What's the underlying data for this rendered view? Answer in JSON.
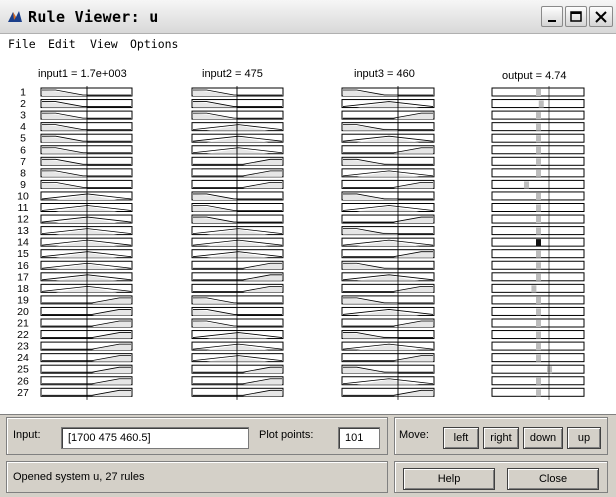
{
  "window": {
    "title": "Rule Viewer: u"
  },
  "menu": [
    "File",
    "Edit",
    "View",
    "Options"
  ],
  "columns": {
    "input1_label": "input1 = 1.7e+003",
    "input2_label": "input2 = 475",
    "input3_label": "input3 = 460",
    "output_label": "output = 4.74"
  },
  "rows": [
    "1",
    "2",
    "3",
    "4",
    "5",
    "6",
    "7",
    "8",
    "9",
    "10",
    "11",
    "12",
    "13",
    "14",
    "15",
    "16",
    "17",
    "18",
    "19",
    "20",
    "21",
    "22",
    "23",
    "24",
    "25",
    "26",
    "27"
  ],
  "rule_mf": {
    "input1": [
      1,
      1,
      1,
      1,
      1,
      1,
      1,
      1,
      1,
      2,
      2,
      2,
      2,
      2,
      2,
      2,
      2,
      2,
      3,
      3,
      3,
      3,
      3,
      3,
      3,
      3,
      3
    ],
    "input2": [
      1,
      1,
      1,
      2,
      2,
      2,
      3,
      3,
      3,
      1,
      1,
      1,
      2,
      2,
      2,
      3,
      3,
      3,
      1,
      1,
      1,
      2,
      2,
      2,
      3,
      3,
      3
    ],
    "input3": [
      1,
      2,
      3,
      1,
      2,
      3,
      1,
      2,
      3,
      1,
      2,
      3,
      1,
      2,
      3,
      1,
      2,
      3,
      1,
      2,
      3,
      1,
      2,
      3,
      1,
      2,
      3
    ],
    "output_pos": [
      0.5,
      0.53,
      0.5,
      0.5,
      0.5,
      0.5,
      0.5,
      0.5,
      0.37,
      0.5,
      0.5,
      0.5,
      0.5,
      0.5,
      0.5,
      0.5,
      0.5,
      0.45,
      0.5,
      0.5,
      0.5,
      0.5,
      0.5,
      0.5,
      0.62,
      0.5,
      0.5
    ]
  },
  "bottom": {
    "input_label": "Input:",
    "input_value": "[1700 475 460.5]",
    "plot_points_label": "Plot points:",
    "plot_points_value": "101",
    "move_label": "Move:",
    "move_buttons": [
      "left",
      "right",
      "down",
      "up"
    ],
    "status": "Opened system u, 27 rules",
    "help": "Help",
    "close": "Close"
  }
}
